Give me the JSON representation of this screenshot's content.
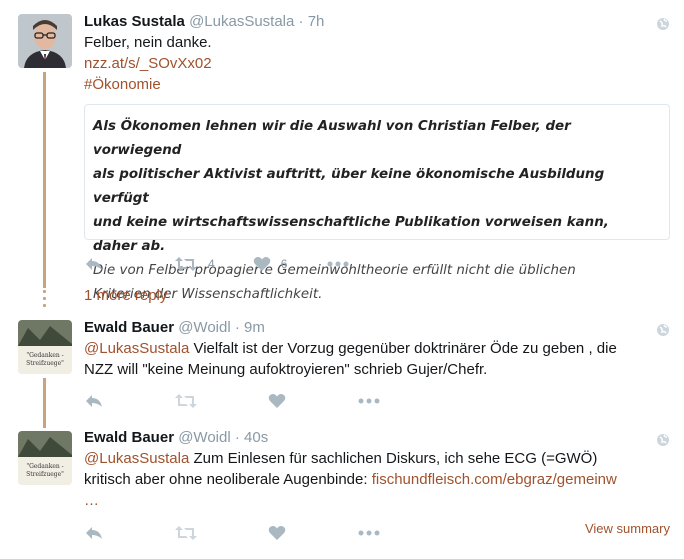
{
  "tweets": [
    {
      "name": "Lukas Sustala",
      "handle": "@LukasSustala",
      "sep": "·",
      "time": "7h",
      "text_line": "Felber, nein danke.",
      "link": "nzz.at/s/_SOvXx02",
      "hashtag": "#Ökonomie",
      "quote": {
        "bold_lines": [
          "Als Ökonomen lehnen wir die Auswahl von Christian Felber, der vorwiegend",
          "als politischer Aktivist auftritt, über keine ökonomische Ausbildung verfügt",
          "und keine wirtschaftswissenschaftliche Publikation vorweisen kann, daher ab."
        ],
        "normal_lines": [
          "Die von Felber propagierte Gemeinwohltheorie erfüllt nicht die üblichen",
          "Kriterien der Wissenschaftlichkeit."
        ]
      },
      "retweets": "4",
      "likes": "6"
    },
    {
      "name": "Ewald Bauer",
      "handle": "@Woidl",
      "sep": "·",
      "time": "9m",
      "mention": "@LukasSustala",
      "text_after_mention": " Vielfalt ist der Vorzug gegenüber doktrinärer Öde zu geben , die",
      "text_line2": "NZZ will \"keine Meinung aufoktroyieren\" schrieb Gujer/Chefr."
    },
    {
      "name": "Ewald Bauer",
      "handle": "@Woidl",
      "sep": "·",
      "time": "40s",
      "mention": "@LukasSustala",
      "text_after_mention": " Zum Einlesen für sachlichen Diskurs, ich sehe ECG (=GWÖ)",
      "text_line2": "kritisch aber ohne neoliberale Augenbinde: ",
      "link": "fischundfleisch.com/ebgraz/gemeinw",
      "ellipsis": "…"
    }
  ],
  "more_reply": "1 more reply",
  "view_summary": "View summary",
  "avatar_caption": [
    "\"Gedanken -",
    "Streifzuege\""
  ],
  "colors": {
    "accent": "#a0522d",
    "thread": "#c9a27e",
    "icon": "#aab8c2",
    "muted": "#8899a6"
  }
}
